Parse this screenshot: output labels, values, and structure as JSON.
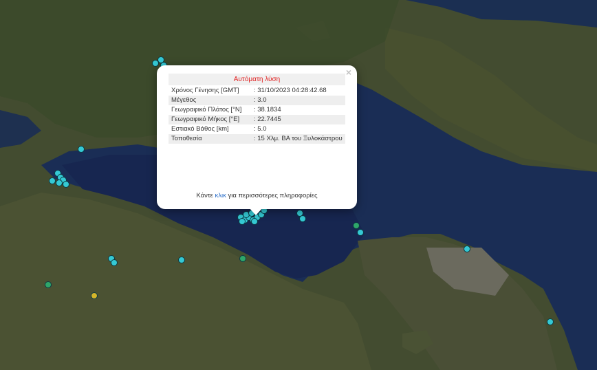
{
  "colors": {
    "water": "#172a52",
    "land": "#434c30",
    "popup_title": "#e02020",
    "link": "#2a6ec9",
    "quake_recent": "#35c9d4",
    "quake_mid": "#2fa66a",
    "quake_old": "#d4b52a"
  },
  "popup": {
    "title": "Αυτόματη λύση",
    "close_icon": "close-icon",
    "rows": [
      {
        "label": "Χρόνος Γένησης [GMT]",
        "value": ": 31/10/2023 04:28:42.68"
      },
      {
        "label": "Μέγεθος",
        "value": ": 3.0"
      },
      {
        "label": "Γεωγραφικό Πλάτος [°N]",
        "value": ": 38.1834"
      },
      {
        "label": "Γεωγραφικό Μήκος [°E]",
        "value": ": 22.7445"
      },
      {
        "label": "Εστιακό Βάθος [km]",
        "value": ": 5.0"
      },
      {
        "label": "Τοποθεσία",
        "value": ": 15 Χλμ. ΒΑ του Ξυλοκάστρου"
      }
    ],
    "more_prefix": "Κάντε ",
    "more_link": "κλικ",
    "more_suffix": " για περισσότερες πληροφορίες"
  }
}
